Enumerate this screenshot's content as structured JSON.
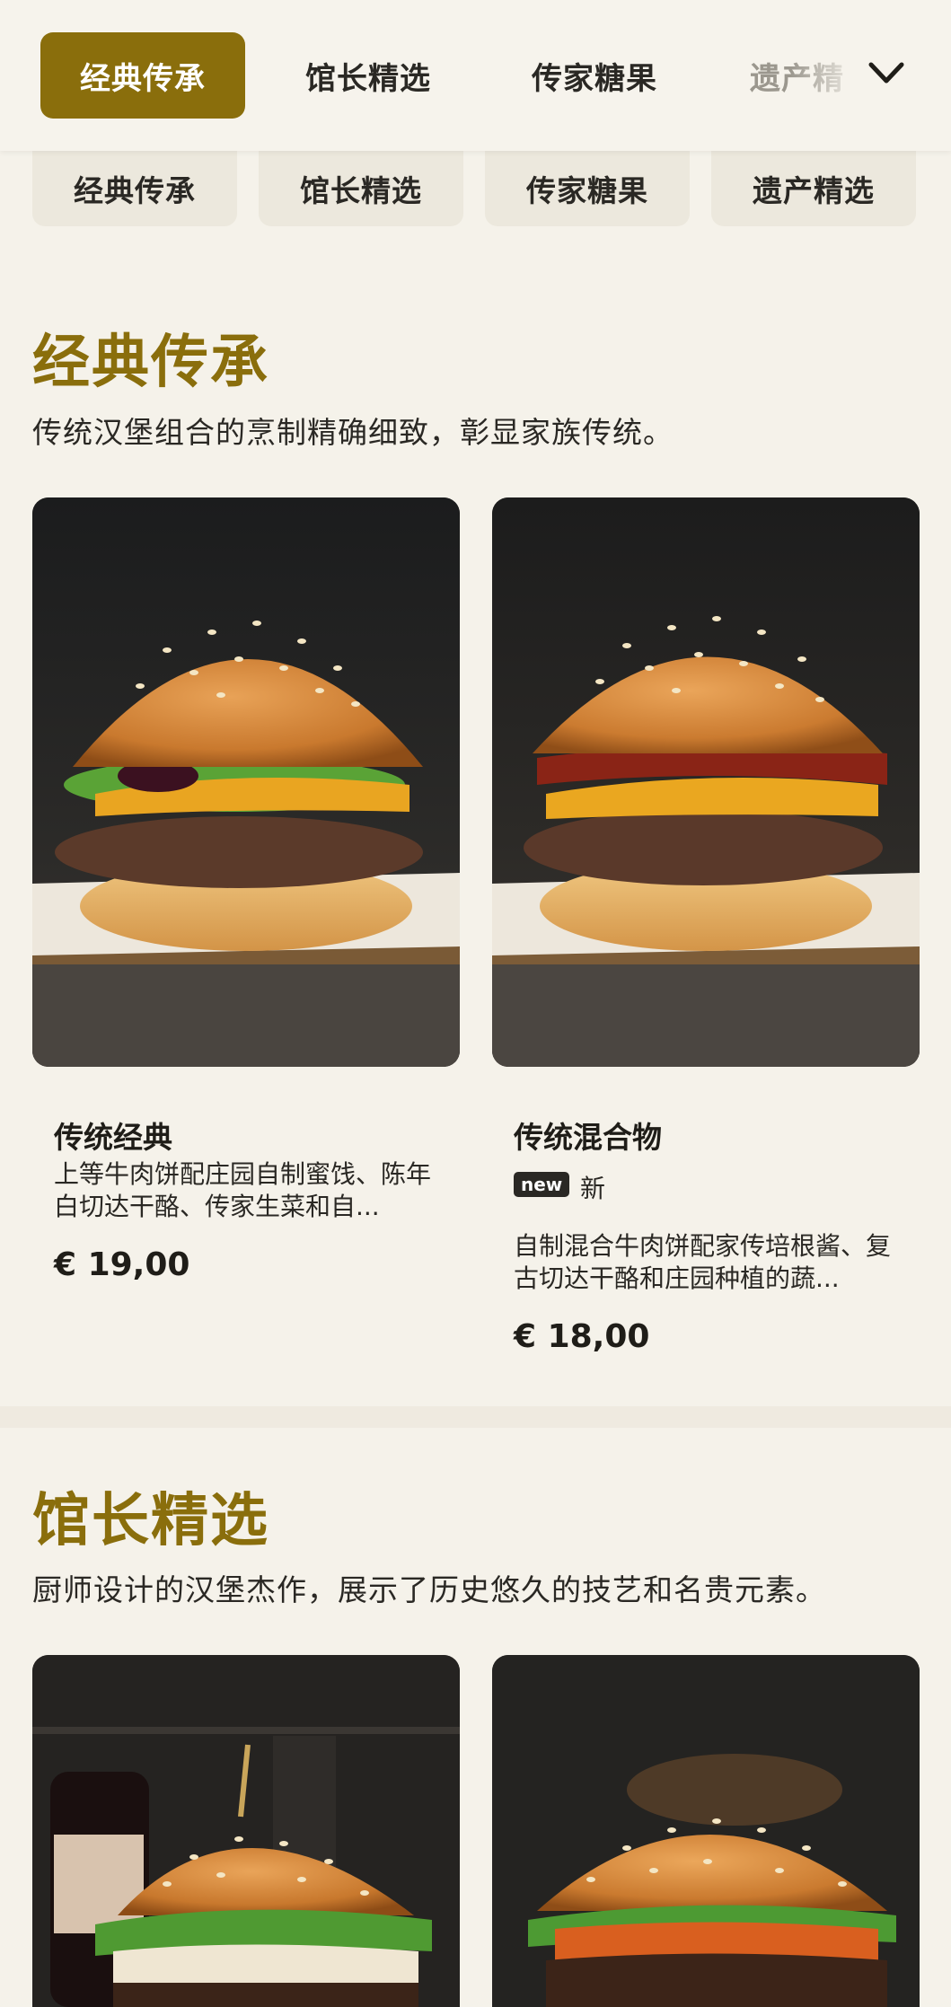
{
  "tabs": {
    "items": [
      "经典传承",
      "馆长精选",
      "传家糖果",
      "遗产精"
    ],
    "active_index": 0
  },
  "chips": [
    "经典传承",
    "馆长精选",
    "传家糖果",
    "遗产精选"
  ],
  "sections": [
    {
      "title": "经典传承",
      "description": "传统汉堡组合的烹制精确细致，彰显家族传统。",
      "products": [
        {
          "name": "传统经典",
          "description": "上等牛肉饼配庄园自制蜜饯、陈年白切达干酪、传家生菜和自...",
          "price": "€ 19,00"
        },
        {
          "name": "传统混合物",
          "badge": "new",
          "badge_text": "新",
          "description": "自制混合牛肉饼配家传培根酱、复古切达干酪和庄园种植的蔬...",
          "price": "€ 18,00"
        }
      ]
    },
    {
      "title": "馆长精选",
      "description": "厨师设计的汉堡杰作，展示了历史悠久的技艺和名贵元素。"
    }
  ],
  "colors": {
    "accent": "#8a6e0c",
    "background": "#f5f2ea"
  }
}
